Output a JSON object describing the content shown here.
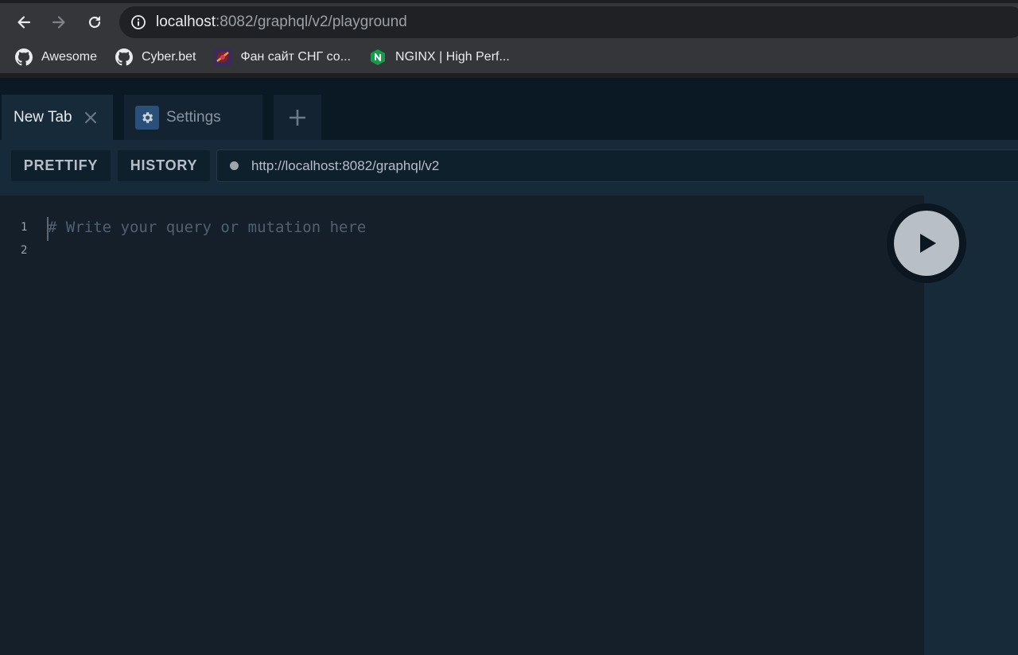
{
  "browser": {
    "url_host": "localhost",
    "url_rest": ":8082/graphql/v2/playground",
    "icons": {
      "back": "arrow-left-icon",
      "forward": "arrow-right-icon",
      "reload": "reload-icon",
      "site_info": "info-circle-icon"
    },
    "bookmarks": [
      {
        "label": "Awesome",
        "icon": "github-icon"
      },
      {
        "label": "Cyber.bet",
        "icon": "github-icon"
      },
      {
        "label": "Фан сайт СНГ со...",
        "icon": "site-favicon"
      },
      {
        "label": "NGINX | High Perf...",
        "icon": "nginx-icon"
      }
    ]
  },
  "playground": {
    "tabs": [
      {
        "label": "New Tab",
        "active": true
      },
      {
        "label": "Settings",
        "active": false
      }
    ],
    "add_tab_icon": "plus-icon",
    "toolbar": {
      "prettify_label": "PRETTIFY",
      "history_label": "HISTORY",
      "endpoint": "http://localhost:8082/graphql/v2"
    },
    "editor": {
      "line_numbers": [
        "1",
        "2"
      ],
      "placeholder": "# Write your query or mutation here"
    },
    "run_icon": "play-icon"
  },
  "colors": {
    "chrome_bg": "#35363a",
    "app_bg": "#0f202d",
    "editor_bg": "#141f2a",
    "toolbar_bg": "#172a3a",
    "settings_icon_bg": "#2a4f78",
    "run_button": "#b8bfc6"
  }
}
